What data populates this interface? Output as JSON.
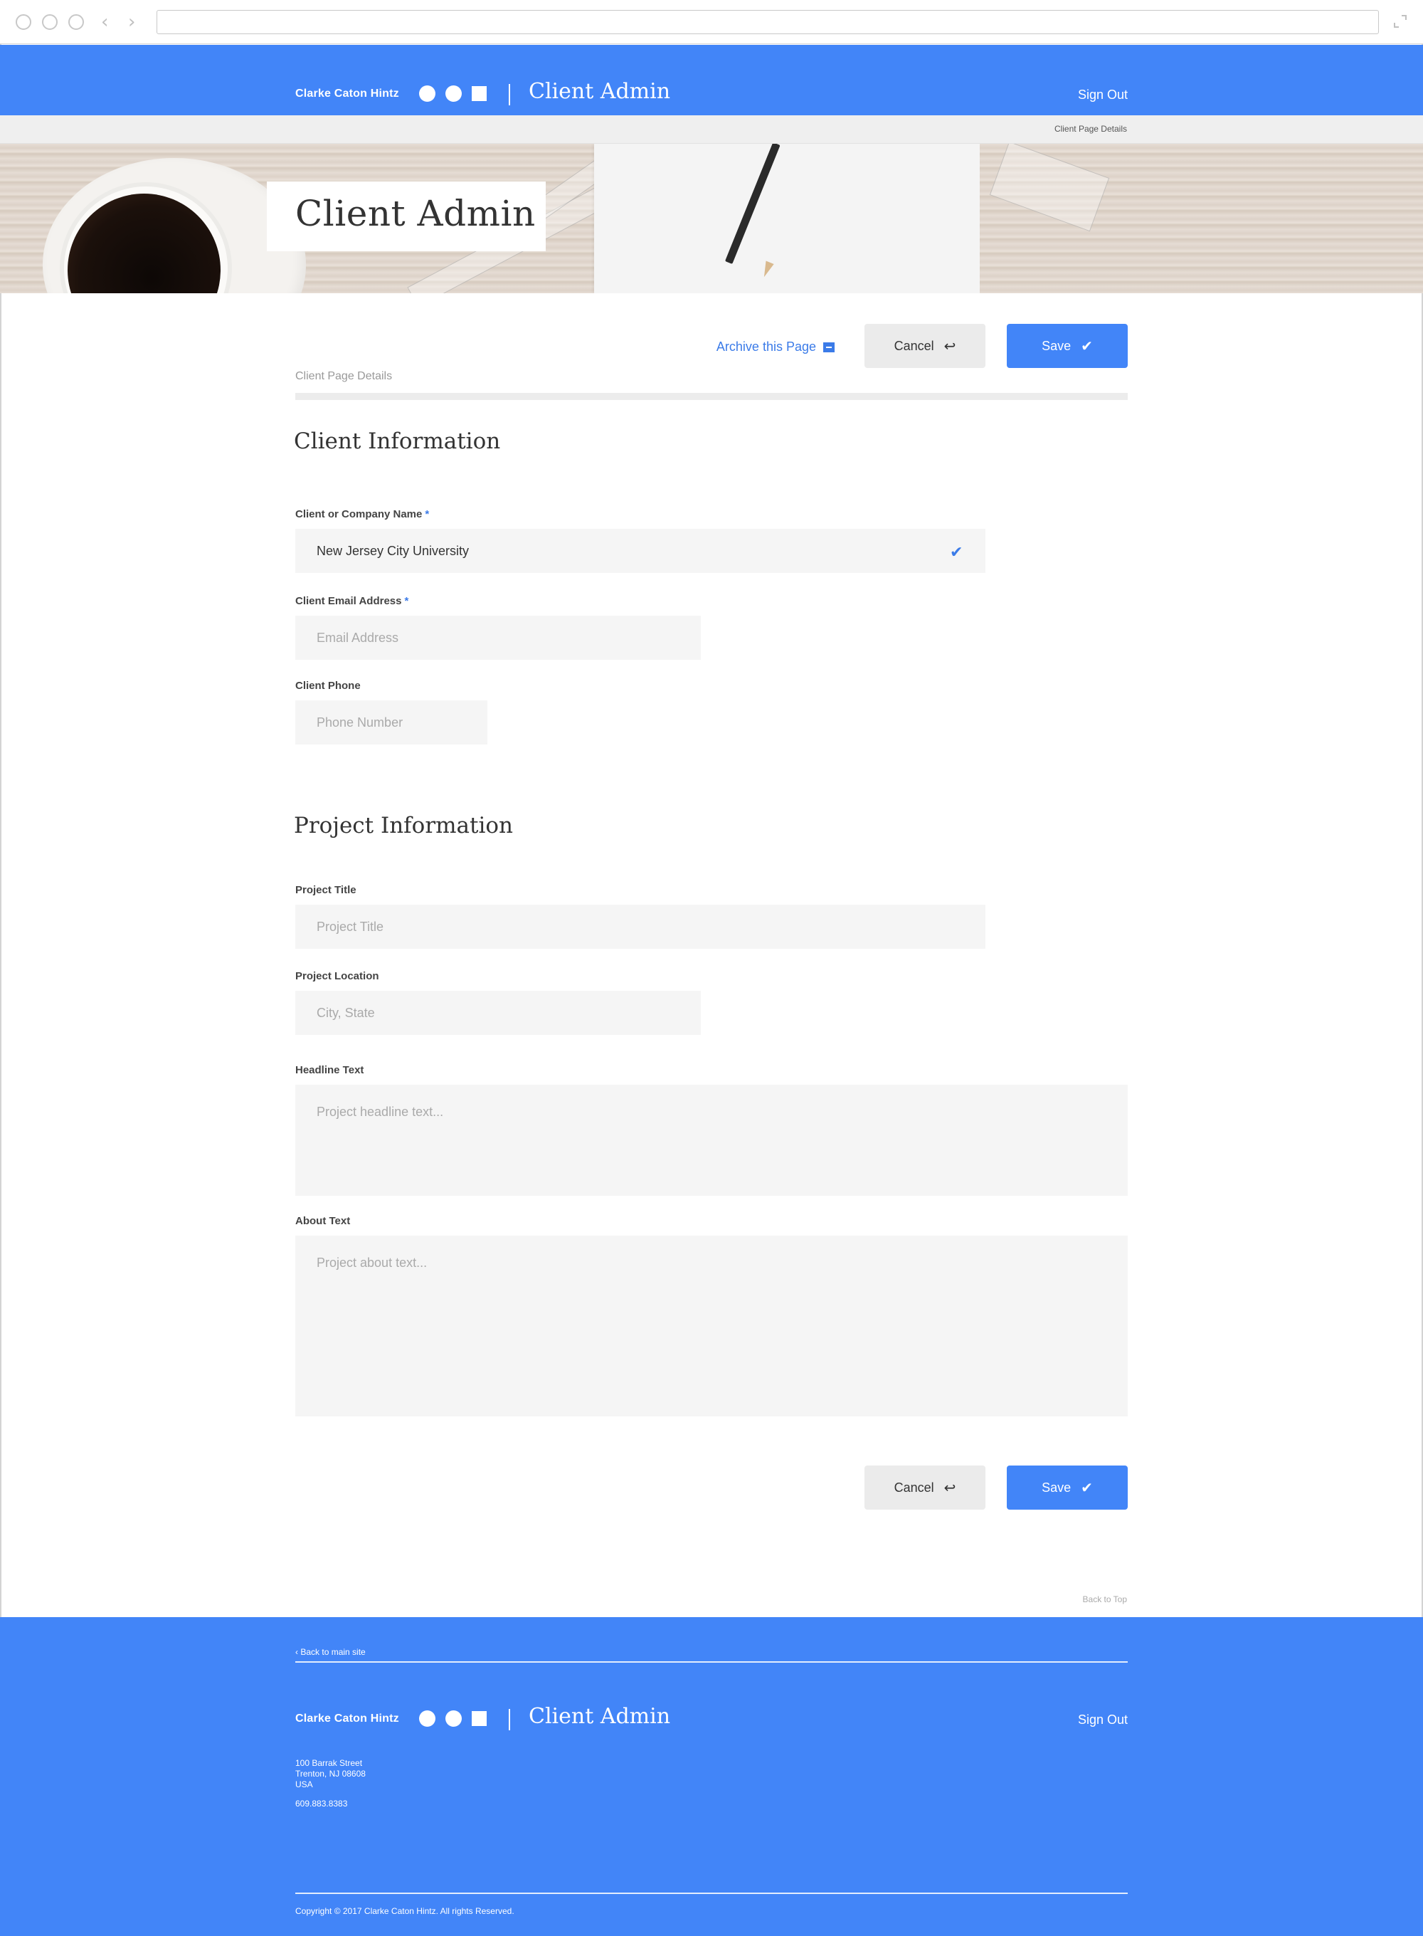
{
  "browser": {
    "url": ""
  },
  "header": {
    "brand": "Clarke Caton Hintz",
    "app_title": "Client Admin",
    "sign_out": "Sign Out"
  },
  "breadcrumb": "Client Page Details",
  "hero": {
    "title": "Client Admin"
  },
  "actions": {
    "archive_label": "Archive this Page",
    "cancel_label": "Cancel",
    "save_label": "Save"
  },
  "page_section": "Client Page Details",
  "client_info": {
    "title": "Client Information",
    "name_label": "Client or Company Name",
    "name_value": "New Jersey City University",
    "email_label": "Client Email Address",
    "email_placeholder": "Email Address",
    "phone_label": "Client Phone",
    "phone_placeholder": "Phone Number",
    "required_mark": "*"
  },
  "project_info": {
    "title": "Project Information",
    "project_title_label": "Project Title",
    "project_title_placeholder": "Project Title",
    "location_label": "Project Location",
    "location_placeholder": "City, State",
    "headline_label": "Headline Text",
    "headline_placeholder": "Project headline text...",
    "about_label": "About Text",
    "about_placeholder": "Project about text..."
  },
  "back_to_top": "Back to Top",
  "footer": {
    "back_main": "Back to main site",
    "brand": "Clarke Caton Hintz",
    "app_title": "Client Admin",
    "sign_out": "Sign Out",
    "address_line1": "100 Barrak Street",
    "address_line2": "Trenton, NJ 08608",
    "address_line3": "USA",
    "phone": "609.883.8383",
    "copyright": "Copyright © 2017 Clarke Caton Hintz. All rights Reserved."
  },
  "colors": {
    "brand_blue": "#4285f8",
    "link_blue": "#3b7be8",
    "field_bg": "#f5f5f5"
  }
}
